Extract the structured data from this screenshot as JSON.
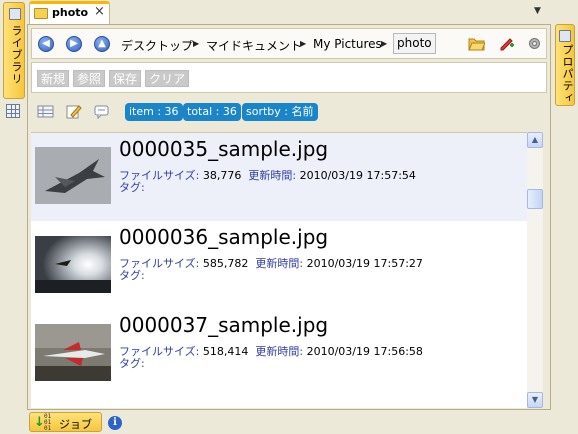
{
  "left_sidebar": {
    "library_tab_label": "ライブラリ",
    "library_icon": "library-icon",
    "grid_icon": "grid-view-icon"
  },
  "right_sidebar": {
    "property_tab_label": "プロパティ",
    "property_icon": "property-icon"
  },
  "tab": {
    "title": "photo",
    "close": "×",
    "menu": "▼"
  },
  "nav": {
    "back_icon": "back-arrow-icon",
    "forward_icon": "forward-arrow-icon",
    "up_icon": "up-arrow-icon",
    "breadcrumbs": [
      "デスクトップ",
      "マイドキュメント",
      "My Pictures",
      "photo"
    ],
    "separator": "▶",
    "tools": [
      "open-folder-icon",
      "edit-tag-icon",
      "settings-gear-icon"
    ]
  },
  "search": {
    "buttons": [
      "新規",
      "参照",
      "保存",
      "クリア"
    ]
  },
  "filter": {
    "icons": [
      "list-view-icon",
      "edit-note-icon",
      "comment-icon"
    ],
    "pills": [
      "item : 36",
      "total : 36",
      "sortby : 名前"
    ]
  },
  "files": [
    {
      "name": "0000035_sample.jpg",
      "size_label": "ファイルサイズ:",
      "size": "38,776",
      "date_label": "更新時間:",
      "date": "2010/03/19 17:57:54",
      "tag_label": "タグ:",
      "thumb": "fighter-jet-photo"
    },
    {
      "name": "0000036_sample.jpg",
      "size_label": "ファイルサイズ:",
      "size": "585,782",
      "date_label": "更新時間:",
      "date": "2010/03/19 17:57:27",
      "tag_label": "タグ:",
      "thumb": "jet-sunset-photo"
    },
    {
      "name": "0000037_sample.jpg",
      "size_label": "ファイルサイズ:",
      "size": "518,414",
      "date_label": "更新時間:",
      "date": "2010/03/19 17:56:58",
      "tag_label": "タグ:",
      "thumb": "red-white-jet-photo"
    }
  ],
  "bottom": {
    "job_label": "ジョブ",
    "job_bits": "01\n01\n01",
    "info": "i"
  },
  "colors": {
    "accent_tab": "#ffb400",
    "pill": "#1a86c9",
    "meta_key": "#2f3fa8"
  }
}
